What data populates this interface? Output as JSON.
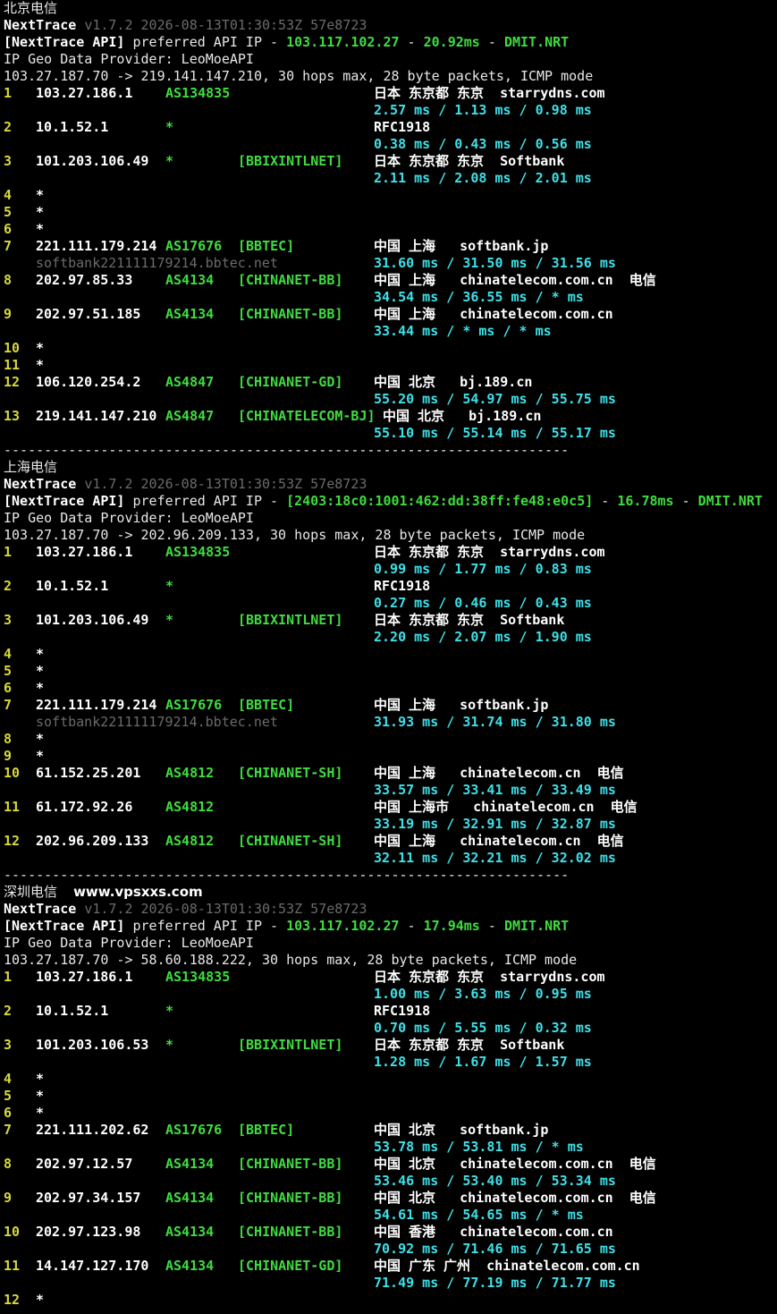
{
  "sections": [
    {
      "title": "北京电信",
      "site": "",
      "nexttrace_name": "NextTrace",
      "version": "v1.7.2 2026-08-13T01:30:53Z 57e8723",
      "api_prefix": "[NextTrace API]",
      "api_text": " preferred API IP - ",
      "api_ip": "103.117.102.27",
      "api_dash1": " - ",
      "api_latency": "20.92ms",
      "api_dash2": " - ",
      "api_node": "DMIT.NRT",
      "geo_provider": "IP Geo Data Provider: LeoMoeAPI",
      "trace_header": "103.27.187.70 -> 219.141.147.210, 30 hops max, 28 byte packets, ICMP mode",
      "lines": [
        {
          "no": "1",
          "ip": "103.27.186.1",
          "asn": "AS134835",
          "tag": "",
          "geo": "日本 东京都 东京  starrydns.com"
        },
        {
          "rtt": "2.57 ms / 1.13 ms / 0.98 ms"
        },
        {
          "no": "2",
          "ip": "10.1.52.1",
          "asn": "*",
          "tag": "",
          "geo": "RFC1918"
        },
        {
          "rtt": "0.38 ms / 0.43 ms / 0.56 ms"
        },
        {
          "no": "3",
          "ip": "101.203.106.49",
          "asn": "*",
          "tag": "[BBIXINTLNET]",
          "geo": "日本 东京都 东京  Softbank"
        },
        {
          "rtt": "2.11 ms / 2.08 ms / 2.01 ms"
        },
        {
          "no": "4",
          "ip": "*"
        },
        {
          "no": "5",
          "ip": "*"
        },
        {
          "no": "6",
          "ip": "*"
        },
        {
          "no": "7",
          "ip": "221.111.179.214",
          "asn": "AS17676",
          "tag": "[BBTEC]",
          "geo": "中国 上海   softbank.jp"
        },
        {
          "host": "softbank221111179214.bbtec.net",
          "rtt": "31.60 ms / 31.50 ms / 31.56 ms"
        },
        {
          "no": "8",
          "ip": "202.97.85.33",
          "asn": "AS4134",
          "tag": "[CHINANET-BB]",
          "geo": "中国 上海   chinatelecom.com.cn  电信"
        },
        {
          "rtt": "34.54 ms / 36.55 ms / * ms"
        },
        {
          "no": "9",
          "ip": "202.97.51.185",
          "asn": "AS4134",
          "tag": "[CHINANET-BB]",
          "geo": "中国 上海   chinatelecom.com.cn"
        },
        {
          "rtt": "33.44 ms / * ms / * ms"
        },
        {
          "no": "10",
          "ip": "*"
        },
        {
          "no": "11",
          "ip": "*"
        },
        {
          "no": "12",
          "ip": "106.120.254.2",
          "asn": "AS4847",
          "tag": "[CHINANET-GD]",
          "geo": "中国 北京   bj.189.cn"
        },
        {
          "rtt": "55.20 ms / 54.97 ms / 55.75 ms"
        },
        {
          "no": "13",
          "ip": "219.141.147.210",
          "asn": "AS4847",
          "tag": "[CHINATELECOM-BJ]",
          "geo": "中国 北京   bj.189.cn",
          "geo_shift": true
        },
        {
          "rtt": "55.10 ms / 55.14 ms / 55.17 ms"
        }
      ]
    },
    {
      "title": "上海电信",
      "site": "",
      "nexttrace_name": "NextTrace",
      "version": "v1.7.2 2026-08-13T01:30:53Z 57e8723",
      "api_prefix": "[NextTrace API]",
      "api_text": " preferred API IP - ",
      "api_ip": "[2403:18c0:1001:462:dd:38ff:fe48:e0c5]",
      "api_dash1": " - ",
      "api_latency": "16.78ms",
      "api_dash2": " - ",
      "api_node": "DMIT.NRT",
      "geo_provider": "IP Geo Data Provider: LeoMoeAPI",
      "trace_header": "103.27.187.70 -> 202.96.209.133, 30 hops max, 28 byte packets, ICMP mode",
      "lines": [
        {
          "no": "1",
          "ip": "103.27.186.1",
          "asn": "AS134835",
          "tag": "",
          "geo": "日本 东京都 东京  starrydns.com"
        },
        {
          "rtt": "0.99 ms / 1.77 ms / 0.83 ms"
        },
        {
          "no": "2",
          "ip": "10.1.52.1",
          "asn": "*",
          "tag": "",
          "geo": "RFC1918"
        },
        {
          "rtt": "0.27 ms / 0.46 ms / 0.43 ms"
        },
        {
          "no": "3",
          "ip": "101.203.106.49",
          "asn": "*",
          "tag": "[BBIXINTLNET]",
          "geo": "日本 东京都 东京  Softbank"
        },
        {
          "rtt": "2.20 ms / 2.07 ms / 1.90 ms"
        },
        {
          "no": "4",
          "ip": "*"
        },
        {
          "no": "5",
          "ip": "*"
        },
        {
          "no": "6",
          "ip": "*"
        },
        {
          "no": "7",
          "ip": "221.111.179.214",
          "asn": "AS17676",
          "tag": "[BBTEC]",
          "geo": "中国 上海   softbank.jp"
        },
        {
          "host": "softbank221111179214.bbtec.net",
          "rtt": "31.93 ms / 31.74 ms / 31.80 ms"
        },
        {
          "no": "8",
          "ip": "*"
        },
        {
          "no": "9",
          "ip": "*"
        },
        {
          "no": "10",
          "ip": "61.152.25.201",
          "asn": "AS4812",
          "tag": "[CHINANET-SH]",
          "geo": "中国 上海   chinatelecom.cn  电信"
        },
        {
          "rtt": "33.57 ms / 33.41 ms / 33.49 ms"
        },
        {
          "no": "11",
          "ip": "61.172.92.26",
          "asn": "AS4812",
          "tag": "",
          "geo": "中国 上海市   chinatelecom.cn  电信"
        },
        {
          "rtt": "33.19 ms / 32.91 ms / 32.87 ms"
        },
        {
          "no": "12",
          "ip": "202.96.209.133",
          "asn": "AS4812",
          "tag": "[CHINANET-SH]",
          "geo": "中国 上海   chinatelecom.cn  电信"
        },
        {
          "rtt": "32.11 ms / 32.21 ms / 32.02 ms"
        }
      ]
    },
    {
      "title": "深圳电信",
      "site": "www.vpsxxs.com",
      "nexttrace_name": "NextTrace",
      "version": "v1.7.2 2026-08-13T01:30:53Z 57e8723",
      "api_prefix": "[NextTrace API]",
      "api_text": " preferred API IP - ",
      "api_ip": "103.117.102.27",
      "api_dash1": " - ",
      "api_latency": "17.94ms",
      "api_dash2": " - ",
      "api_node": "DMIT.NRT",
      "geo_provider": "IP Geo Data Provider: LeoMoeAPI",
      "trace_header": "103.27.187.70 -> 58.60.188.222, 30 hops max, 28 byte packets, ICMP mode",
      "lines": [
        {
          "no": "1",
          "ip": "103.27.186.1",
          "asn": "AS134835",
          "tag": "",
          "geo": "日本 东京都 东京  starrydns.com"
        },
        {
          "rtt": "1.00 ms / 3.63 ms / 0.95 ms"
        },
        {
          "no": "2",
          "ip": "10.1.52.1",
          "asn": "*",
          "tag": "",
          "geo": "RFC1918"
        },
        {
          "rtt": "0.70 ms / 5.55 ms / 0.32 ms"
        },
        {
          "no": "3",
          "ip": "101.203.106.53",
          "asn": "*",
          "tag": "[BBIXINTLNET]",
          "geo": "日本 东京都 东京  Softbank"
        },
        {
          "rtt": "1.28 ms / 1.67 ms / 1.57 ms"
        },
        {
          "no": "4",
          "ip": "*"
        },
        {
          "no": "5",
          "ip": "*"
        },
        {
          "no": "6",
          "ip": "*"
        },
        {
          "no": "7",
          "ip": "221.111.202.62",
          "asn": "AS17676",
          "tag": "[BBTEC]",
          "geo": "中国 北京   softbank.jp"
        },
        {
          "rtt": "53.78 ms / 53.81 ms / * ms"
        },
        {
          "no": "8",
          "ip": "202.97.12.57",
          "asn": "AS4134",
          "tag": "[CHINANET-BB]",
          "geo": "中国 北京   chinatelecom.com.cn  电信"
        },
        {
          "rtt": "53.46 ms / 53.40 ms / 53.34 ms"
        },
        {
          "no": "9",
          "ip": "202.97.34.157",
          "asn": "AS4134",
          "tag": "[CHINANET-BB]",
          "geo": "中国 北京   chinatelecom.com.cn  电信"
        },
        {
          "rtt": "54.61 ms / 54.65 ms / * ms"
        },
        {
          "no": "10",
          "ip": "202.97.123.98",
          "asn": "AS4134",
          "tag": "[CHINANET-BB]",
          "geo": "中国 香港   chinatelecom.com.cn"
        },
        {
          "rtt": "70.92 ms / 71.46 ms / 71.65 ms"
        },
        {
          "no": "11",
          "ip": "14.147.127.170",
          "asn": "AS4134",
          "tag": "[CHINANET-GD]",
          "geo": "中国 广东 广州  chinatelecom.com.cn"
        },
        {
          "rtt": "71.49 ms / 77.19 ms / 71.77 ms"
        },
        {
          "no": "12",
          "ip": "*"
        }
      ]
    }
  ],
  "separator": "----------------------------------------------------------------------"
}
